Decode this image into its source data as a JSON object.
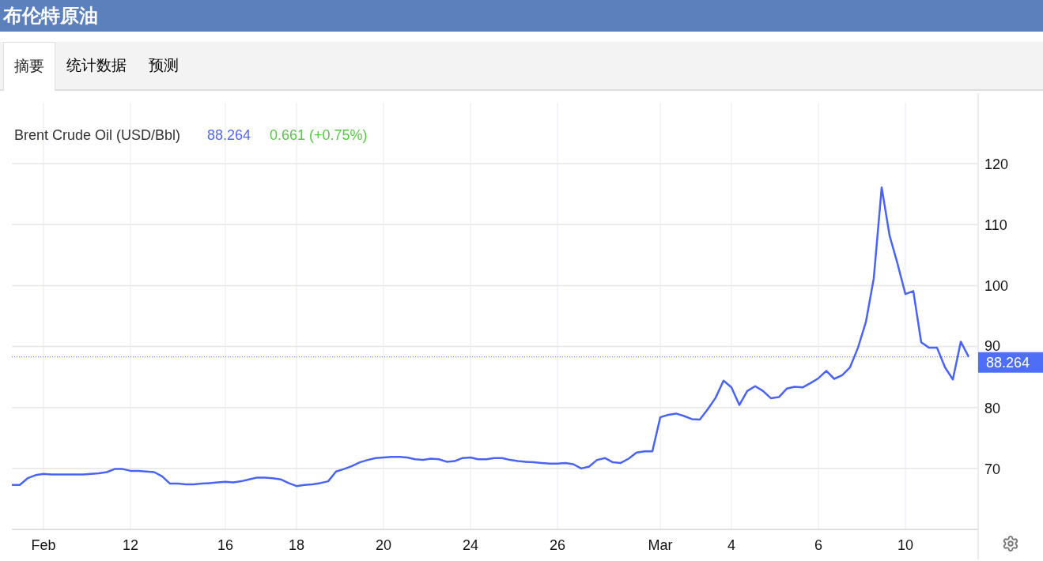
{
  "header": {
    "title": "布伦特原油"
  },
  "tabs": [
    {
      "label": "摘要",
      "selected": true
    },
    {
      "label": "统计数据",
      "selected": false
    },
    {
      "label": "预测",
      "selected": false
    }
  ],
  "legend": {
    "price": "88.264",
    "change": "0.661 (+0.75%)"
  },
  "price_label": "88.264",
  "chart_data": {
    "type": "line",
    "grid": true,
    "categories": [
      null,
      null,
      null,
      null,
      "Feb",
      null,
      null,
      null,
      null,
      null,
      null,
      null,
      null,
      null,
      null,
      "12",
      null,
      null,
      null,
      null,
      null,
      null,
      null,
      null,
      null,
      null,
      null,
      "16",
      null,
      null,
      null,
      null,
      null,
      null,
      null,
      null,
      "18",
      null,
      null,
      null,
      null,
      null,
      null,
      null,
      null,
      null,
      null,
      "20",
      null,
      null,
      null,
      null,
      null,
      null,
      null,
      null,
      null,
      null,
      "24",
      null,
      null,
      null,
      null,
      null,
      null,
      null,
      null,
      null,
      null,
      "26",
      null,
      null,
      null,
      null,
      null,
      null,
      null,
      null,
      null,
      null,
      null,
      null,
      "Mar",
      null,
      null,
      null,
      null,
      null,
      null,
      null,
      null,
      "4",
      null,
      null,
      null,
      null,
      null,
      null,
      null,
      null,
      null,
      null,
      "6",
      null,
      null,
      null,
      null,
      null,
      null,
      null,
      null,
      null,
      null,
      "10",
      null,
      null,
      null,
      null,
      null,
      null,
      null,
      null
    ],
    "series": [
      {
        "name": "Brent Crude Oil (USD/Bbl)",
        "color": "#4a63f5",
        "values": [
          67.3,
          67.3,
          68.4,
          68.9,
          69.1,
          69.0,
          69.0,
          69.0,
          69.0,
          69.0,
          69.1,
          69.2,
          69.4,
          69.9,
          69.9,
          69.6,
          69.6,
          69.5,
          69.4,
          68.7,
          67.5,
          67.5,
          67.4,
          67.4,
          67.5,
          67.6,
          67.7,
          67.8,
          67.7,
          67.9,
          68.2,
          68.5,
          68.5,
          68.4,
          68.2,
          67.6,
          67.1,
          67.3,
          67.4,
          67.6,
          67.9,
          69.5,
          69.9,
          70.4,
          71.0,
          71.4,
          71.7,
          71.8,
          71.9,
          71.9,
          71.8,
          71.5,
          71.4,
          71.6,
          71.5,
          71.1,
          71.2,
          71.7,
          71.8,
          71.5,
          71.5,
          71.7,
          71.7,
          71.4,
          71.2,
          71.1,
          71.0,
          70.9,
          70.8,
          70.8,
          70.9,
          70.7,
          70.0,
          70.3,
          71.4,
          71.7,
          71.0,
          70.9,
          71.6,
          72.6,
          72.8,
          72.8,
          78.4,
          78.8,
          79.0,
          78.6,
          78.1,
          78.0,
          79.7,
          81.6,
          84.4,
          83.3,
          80.4,
          82.7,
          83.5,
          82.7,
          81.5,
          81.7,
          83.1,
          83.4,
          83.3,
          84.0,
          84.8,
          86.0,
          84.7,
          85.3,
          86.6,
          89.8,
          94.0,
          101.2,
          116.1,
          108.2,
          103.6,
          98.6,
          99.1,
          90.7,
          89.8,
          89.8,
          86.6,
          84.6,
          90.8,
          88.3
        ]
      },
      {
        "color": "#5567f5",
        "line_style": "dotted",
        "values": [
          88.3,
          88.3,
          88.3,
          88.3,
          88.3,
          88.3,
          88.3,
          88.3,
          88.3,
          88.3,
          88.3,
          88.3,
          88.3,
          88.3,
          88.3,
          88.3,
          88.3,
          88.3,
          88.3,
          88.3,
          88.3,
          88.3,
          88.3,
          88.3,
          88.3,
          88.3,
          88.3,
          88.3,
          88.3,
          88.3,
          88.3,
          88.3,
          88.3,
          88.3,
          88.3,
          88.3,
          88.3,
          88.3,
          88.3,
          88.3,
          88.3,
          88.3,
          88.3,
          88.3,
          88.3,
          88.3,
          88.3,
          88.3,
          88.3,
          88.3,
          88.3,
          88.3,
          88.3,
          88.3,
          88.3,
          88.3,
          88.3,
          88.3,
          88.3,
          88.3,
          88.3,
          88.3,
          88.3,
          88.3,
          88.3,
          88.3,
          88.3,
          88.3,
          88.3,
          88.3,
          88.3,
          88.3,
          88.3,
          88.3,
          88.3,
          88.3,
          88.3,
          88.3,
          88.3,
          88.3,
          88.3,
          88.3,
          88.3,
          88.3,
          88.3,
          88.3,
          88.3,
          88.3,
          88.3,
          88.3,
          88.3,
          88.3,
          88.3,
          88.3,
          88.3,
          88.3,
          88.3,
          88.3,
          88.3,
          88.3,
          88.3,
          88.3,
          88.3,
          88.3,
          88.3,
          88.3,
          88.3,
          88.3,
          88.3,
          88.3,
          88.3,
          88.3,
          88.3,
          88.3,
          88.3,
          88.3,
          88.3,
          88.3,
          88.3,
          88.3,
          88.3,
          88.3
        ]
      }
    ],
    "ylim": [
      60,
      130
    ],
    "yticks": [
      70,
      80,
      90,
      100,
      110,
      120
    ]
  }
}
